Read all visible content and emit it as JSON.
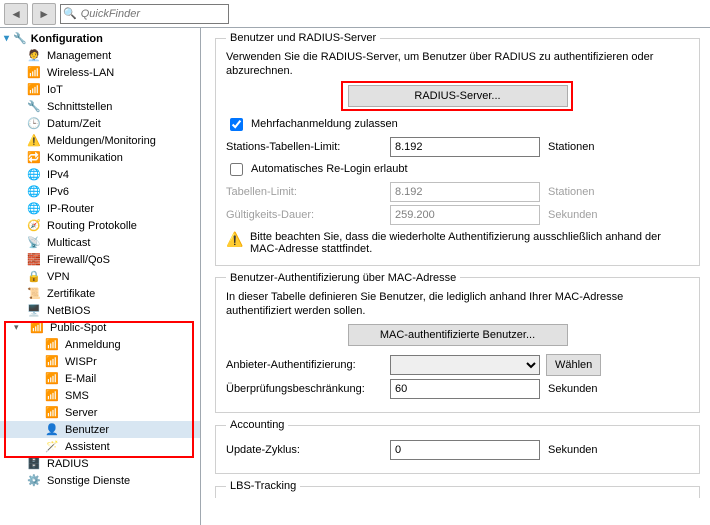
{
  "search": {
    "placeholder": "QuickFinder"
  },
  "tree": {
    "root": "Konfiguration",
    "items": [
      {
        "label": "Management",
        "icon": "🧑‍💼"
      },
      {
        "label": "Wireless-LAN",
        "icon": "📶"
      },
      {
        "label": "IoT",
        "icon": "📶"
      },
      {
        "label": "Schnittstellen",
        "icon": "🔧"
      },
      {
        "label": "Datum/Zeit",
        "icon": "🕒"
      },
      {
        "label": "Meldungen/Monitoring",
        "icon": "⚠️"
      },
      {
        "label": "Kommunikation",
        "icon": "🔁"
      },
      {
        "label": "IPv4",
        "icon": "🌐"
      },
      {
        "label": "IPv6",
        "icon": "🌐"
      },
      {
        "label": "IP-Router",
        "icon": "🌐"
      },
      {
        "label": "Routing Protokolle",
        "icon": "🧭"
      },
      {
        "label": "Multicast",
        "icon": "📡"
      },
      {
        "label": "Firewall/QoS",
        "icon": "🧱"
      },
      {
        "label": "VPN",
        "icon": "🔒"
      },
      {
        "label": "Zertifikate",
        "icon": "📜"
      },
      {
        "label": "NetBIOS",
        "icon": "🖥️"
      }
    ],
    "publicSpot": {
      "label": "Public-Spot",
      "icon": "📶",
      "children": [
        {
          "label": "Anmeldung",
          "icon": "📶"
        },
        {
          "label": "WISPr",
          "icon": "📶"
        },
        {
          "label": "E-Mail",
          "icon": "📶"
        },
        {
          "label": "SMS",
          "icon": "📶"
        },
        {
          "label": "Server",
          "icon": "📶"
        },
        {
          "label": "Benutzer",
          "icon": "👤",
          "selected": true
        },
        {
          "label": "Assistent",
          "icon": "🪄"
        }
      ]
    },
    "tail": [
      {
        "label": "RADIUS",
        "icon": "🗄️"
      },
      {
        "label": "Sonstige Dienste",
        "icon": "⚙️"
      }
    ]
  },
  "panel": {
    "group1": {
      "legend": "Benutzer und RADIUS-Server",
      "desc": "Verwenden Sie die RADIUS-Server, um Benutzer über RADIUS zu authentifizieren oder abzurechnen.",
      "radiusBtn": "RADIUS-Server...",
      "chkMulti": "Mehrfachanmeldung zulassen",
      "chkMultiVal": true,
      "stationLimitLbl": "Stations-Tabellen-Limit:",
      "stationLimitVal": "8.192",
      "stationLimitUnit": "Stationen",
      "chkAuto": "Automatisches Re-Login erlaubt",
      "chkAutoVal": false,
      "tabLimitLbl": "Tabellen-Limit:",
      "tabLimitVal": "8.192",
      "tabLimitUnit": "Stationen",
      "validLbl": "Gültigkeits-Dauer:",
      "validVal": "259.200",
      "validUnit": "Sekunden",
      "warn": "Bitte beachten Sie, dass die wiederholte Authentifizierung ausschließlich anhand der MAC-Adresse stattfindet."
    },
    "group2": {
      "legend": "Benutzer-Authentifizierung über MAC-Adresse",
      "desc": "In dieser Tabelle definieren Sie Benutzer, die lediglich anhand Ihrer MAC-Adresse authentifiziert werden sollen.",
      "macBtn": "MAC-authentifizierte Benutzer...",
      "providerLbl": "Anbieter-Authentifizierung:",
      "providerBtn": "Wählen",
      "checkLbl": "Überprüfungsbeschränkung:",
      "checkVal": "60",
      "checkUnit": "Sekunden"
    },
    "group3": {
      "legend": "Accounting",
      "updateLbl": "Update-Zyklus:",
      "updateVal": "0",
      "updateUnit": "Sekunden"
    },
    "group4": {
      "legend": "LBS-Tracking"
    }
  }
}
